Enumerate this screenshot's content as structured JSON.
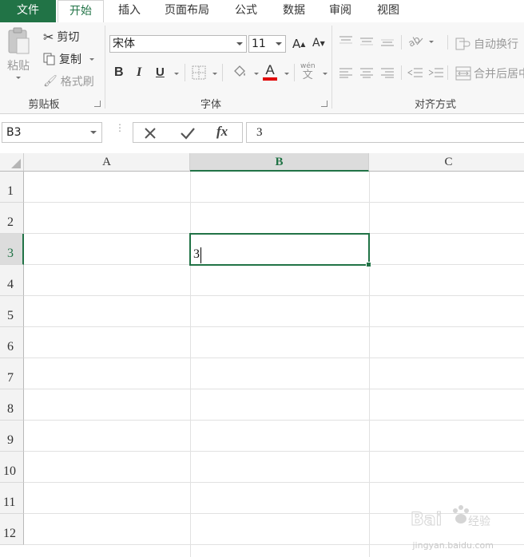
{
  "tabs": [
    "文件",
    "开始",
    "插入",
    "页面布局",
    "公式",
    "数据",
    "审阅",
    "视图"
  ],
  "ribbon": {
    "clipboard": {
      "paste": "粘贴",
      "cut": "剪切",
      "copy": "复制",
      "format_painter": "格式刷",
      "label": "剪贴板"
    },
    "font": {
      "name": "宋体",
      "size": "11",
      "bold": "B",
      "italic": "I",
      "underline": "U",
      "font_color_glyph": "A",
      "grow": "A",
      "shrink": "A",
      "phonetic": "wén",
      "label": "字体"
    },
    "alignment": {
      "wrap_text": "自动换行",
      "merge_center": "合并后居中",
      "label": "对齐方式"
    }
  },
  "formula_bar": {
    "name_box": "B3",
    "fx": "fx",
    "value": "3"
  },
  "sheet": {
    "columns": [
      "A",
      "B",
      "C"
    ],
    "selected_column": "B",
    "rows": [
      "1",
      "2",
      "3",
      "4",
      "5",
      "6",
      "7",
      "8",
      "9",
      "10",
      "11",
      "12"
    ],
    "selected_row": "3",
    "active_cell": {
      "ref": "B3",
      "value": "3"
    }
  },
  "watermark": {
    "text": "jingyan.baidu.com",
    "logo": "Baidu经验"
  },
  "colors": {
    "accent": "#217346",
    "font_color_bar": "#e00000"
  }
}
